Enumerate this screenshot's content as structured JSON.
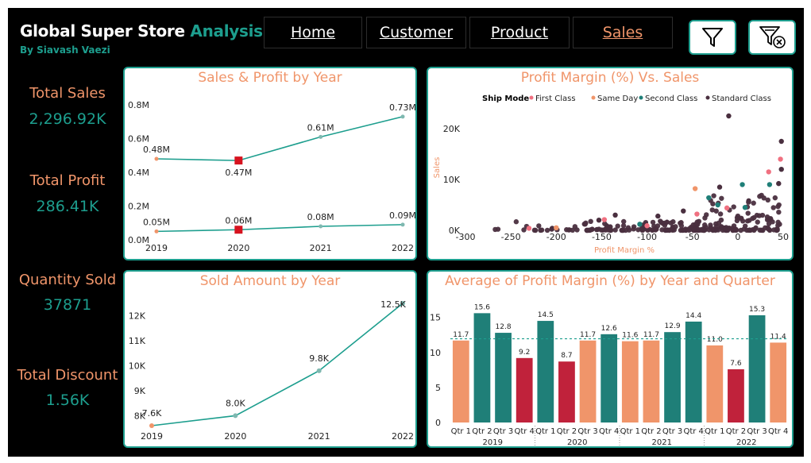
{
  "header": {
    "title_main": "Global Super Store ",
    "title_accent": "Analysis",
    "byline": "By Siavash Vaezi"
  },
  "nav": {
    "home": "Home",
    "customer": "Customer",
    "product": "Product",
    "sales": "Sales",
    "active": "Sales"
  },
  "icons": {
    "filter": "filter-icon",
    "clear_filter": "clear-filter-icon"
  },
  "colors": {
    "background": "#000000",
    "accent": "#1d9e8e",
    "orange": "#f0956a",
    "red": "#c0223b",
    "teal": "#1f7f78",
    "dark": "#4a2f3f"
  },
  "kpis": {
    "total_sales": {
      "label": "Total Sales",
      "value": "2,296.92K"
    },
    "total_profit": {
      "label": "Total Profit",
      "value": "286.41K"
    },
    "quantity_sold": {
      "label": "Quantity Sold",
      "value": "37871"
    },
    "total_discount": {
      "label": "Total Discount",
      "value": "1.56K"
    }
  },
  "chart_data": [
    {
      "id": "sales_profit",
      "type": "line",
      "title": "Sales & Profit by Year",
      "x": [
        "2019",
        "2020",
        "2021",
        "2022"
      ],
      "y_ticks": [
        "0.0M",
        "0.2M",
        "0.4M",
        "0.6M",
        "0.8M"
      ],
      "ylim": [
        0,
        0.8
      ],
      "series": [
        {
          "values": [
            0.48,
            0.47,
            0.61,
            0.73
          ],
          "labels": [
            "0.48M",
            "0.47M",
            "0.61M",
            "0.73M"
          ]
        },
        {
          "values": [
            0.05,
            0.06,
            0.08,
            0.09
          ],
          "labels": [
            "0.05M",
            "0.06M",
            "0.08M",
            "0.09M"
          ]
        }
      ],
      "highlighted_year": "2020"
    },
    {
      "id": "profit_margin_vs_sales",
      "type": "scatter",
      "title": "Profit Margin (%) Vs. Sales",
      "xlabel": "Profit Margin %",
      "ylabel": "Sales",
      "x_ticks": [
        "-300",
        "-250",
        "-200",
        "-150",
        "-100",
        "-50",
        "0",
        "50"
      ],
      "y_ticks": [
        "0K",
        "10K",
        "20K"
      ],
      "xlim": [
        -300,
        50
      ],
      "ylim": [
        0,
        25000
      ],
      "legend_title": "Ship Mode",
      "legend": [
        {
          "name": "First Class",
          "color": "#f07080"
        },
        {
          "name": "Same Day",
          "color": "#f0956a"
        },
        {
          "name": "Second Class",
          "color": "#1f7f78"
        },
        {
          "name": "Standard Class",
          "color": "#4a2f3f"
        }
      ],
      "highlight_points": [
        {
          "x": -10,
          "y": 22500,
          "s": "Standard Class"
        },
        {
          "x": 48,
          "y": 17500,
          "s": "Standard Class"
        },
        {
          "x": 47,
          "y": 14000,
          "s": "First Class"
        },
        {
          "x": 34,
          "y": 11500,
          "s": "First Class"
        },
        {
          "x": 48,
          "y": 12000,
          "s": "Standard Class"
        },
        {
          "x": 35,
          "y": 9000,
          "s": "Second Class"
        },
        {
          "x": 45,
          "y": 9200,
          "s": "Standard Class"
        },
        {
          "x": -47,
          "y": 8200,
          "s": "Same Day"
        },
        {
          "x": 5,
          "y": 9000,
          "s": "Second Class"
        },
        {
          "x": -20,
          "y": 8500,
          "s": "Standard Class"
        },
        {
          "x": -32,
          "y": 6400,
          "s": "Second Class"
        },
        {
          "x": -22,
          "y": 5000,
          "s": "Second Class"
        },
        {
          "x": -12,
          "y": 4400,
          "s": "First Class"
        },
        {
          "x": -45,
          "y": 3200,
          "s": "First Class"
        },
        {
          "x": 8,
          "y": 4500,
          "s": "Second Class"
        },
        {
          "x": 12,
          "y": 5800,
          "s": "Standard Class"
        },
        {
          "x": -147,
          "y": 2100,
          "s": "First Class"
        },
        {
          "x": -135,
          "y": 3000,
          "s": "Standard Class"
        },
        {
          "x": -153,
          "y": 2000,
          "s": "Standard Class"
        },
        {
          "x": -78,
          "y": 1600,
          "s": "Standard Class"
        },
        {
          "x": -88,
          "y": 2800,
          "s": "Standard Class"
        },
        {
          "x": -108,
          "y": 1200,
          "s": "Second Class"
        },
        {
          "x": -60,
          "y": 3800,
          "s": "Standard Class"
        },
        {
          "x": -100,
          "y": 900,
          "s": "First Class"
        },
        {
          "x": -200,
          "y": 500,
          "s": "Same Day"
        },
        {
          "x": -230,
          "y": 400,
          "s": "First Class"
        }
      ]
    },
    {
      "id": "sold_amount",
      "type": "line",
      "title": "Sold Amount by Year",
      "x": [
        "2019",
        "2020",
        "2021",
        "2022"
      ],
      "y_ticks": [
        "8K",
        "9K",
        "10K",
        "11K",
        "12K"
      ],
      "ylim": [
        7.6,
        12.5
      ],
      "values": [
        7.6,
        8.0,
        9.8,
        12.5
      ],
      "labels": [
        "7.6K",
        "8.0K",
        "9.8K",
        "12.5K"
      ]
    },
    {
      "id": "avg_profit_margin",
      "type": "bar",
      "title": "Average of Profit Margin (%) by Year and Quarter",
      "years": [
        "2019",
        "2020",
        "2021",
        "2022"
      ],
      "quarters": [
        "Qtr 1",
        "Qtr 2",
        "Qtr 3",
        "Qtr 4"
      ],
      "values": [
        11.7,
        15.6,
        12.8,
        9.2,
        14.5,
        8.7,
        11.7,
        12.6,
        11.6,
        11.7,
        12.9,
        14.4,
        11.0,
        7.6,
        15.3,
        11.4
      ],
      "labels": [
        "11.7",
        "15.6",
        "12.8",
        "9.2",
        "14.5",
        "8.7",
        "11.7",
        "12.6",
        "11.6",
        "11.7",
        "12.9",
        "14.4",
        "11.0",
        "7.6",
        "15.3",
        "11.4"
      ],
      "colors": [
        "orange",
        "teal",
        "teal",
        "red",
        "teal",
        "red",
        "orange",
        "teal",
        "orange",
        "orange",
        "teal",
        "teal",
        "orange",
        "red",
        "teal",
        "orange"
      ],
      "y_ticks": [
        "0",
        "5",
        "10",
        "15"
      ],
      "ylim": [
        0,
        17
      ],
      "average_line": 11.95
    }
  ]
}
